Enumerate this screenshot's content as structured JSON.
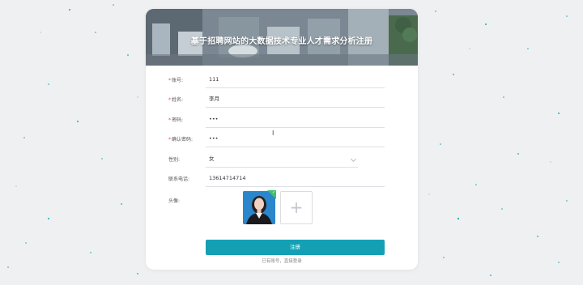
{
  "page": {
    "title": "基于招聘网站的大数据技术专业人才需求分析注册"
  },
  "form": {
    "fields": [
      {
        "label": "账号:",
        "required": true,
        "value": "111"
      },
      {
        "label": "姓名:",
        "required": true,
        "value": "李月"
      },
      {
        "label": "密码:",
        "required": true,
        "value": "•••"
      },
      {
        "label": "确认密码:",
        "required": true,
        "value": "•••"
      },
      {
        "label": "性别:",
        "required": false,
        "value": "女"
      },
      {
        "label": "联系电话:",
        "required": false,
        "value": "13614714714"
      }
    ],
    "avatar_label": "头像:",
    "upload_icon": "+",
    "submit_label": "注册",
    "login_link": "已有账号，直接登录"
  },
  "colors": {
    "accent": "#13a0b4",
    "required": "#e04848",
    "upload_badge": "#3fbf6e"
  },
  "icons": {
    "select": "chevron-down-icon",
    "upload": "plus-icon",
    "badge": "check-icon"
  }
}
